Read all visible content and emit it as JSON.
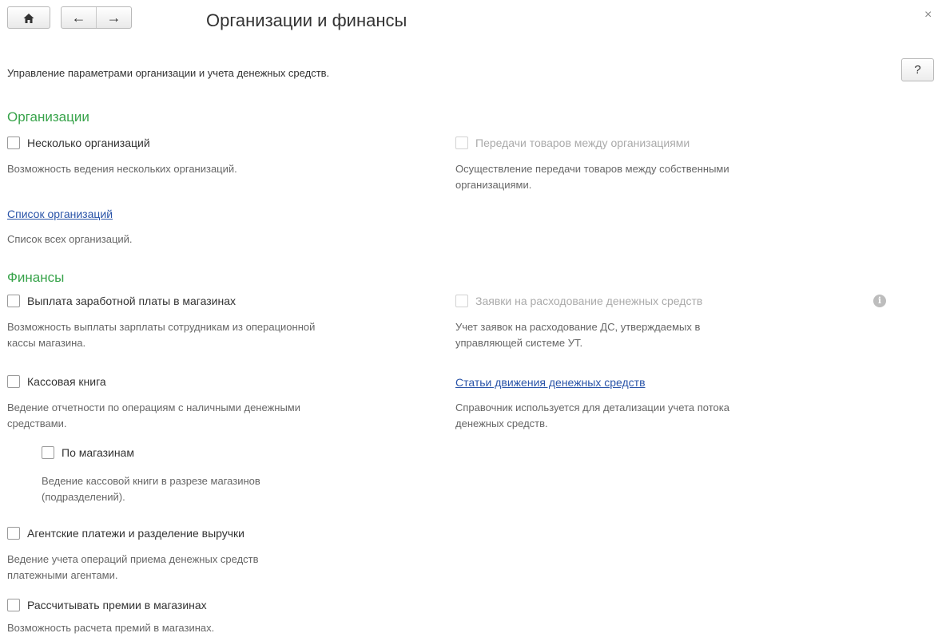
{
  "header": {
    "home_icon": "home-icon",
    "back_icon": "arrow-left-icon",
    "forward_icon": "arrow-right-icon",
    "title": "Организации и финансы",
    "close_icon": "close-icon"
  },
  "description": "Управление параметрами организации и учета денежных средств.",
  "help_label": "?",
  "organizations": {
    "title": "Организации",
    "multi_org_label": "Несколько организаций",
    "multi_org_note": "Возможность ведения нескольких организаций.",
    "transfer_label": "Передачи товаров между организациями",
    "transfer_note_1": "Осуществление передачи товаров между собственными",
    "transfer_note_2": "организациями.",
    "list_link": "Список организаций",
    "list_note": "Список всех организаций."
  },
  "finance": {
    "title": "Финансы",
    "salary_label": "Выплата заработной платы в магазинах",
    "salary_note_1": "Возможность выплаты зарплаты сотрудникам из операционной",
    "salary_note_2": "кассы магазина.",
    "requests_label": "Заявки на расходование денежных средств",
    "requests_note_1": "Учет заявок на расходование ДС, утверждаемых в",
    "requests_note_2": "управляющей системе УТ.",
    "cashbook_label": "Кассовая книга",
    "cashbook_note_1": "Ведение отчетности по операциям с наличными денежными",
    "cashbook_note_2": "средствами.",
    "cashflow_link": "Статьи движения денежных средств",
    "cashflow_note_1": "Справочник используется для детализации учета потока",
    "cashflow_note_2": "денежных средств.",
    "by_stores_label": "По магазинам",
    "by_stores_note_1": "Ведение кассовой книги в разрезе магазинов",
    "by_stores_note_2": "(подразделений).",
    "agent_label": "Агентские платежи и разделение выручки",
    "agent_note_1": "Ведение учета операций приема денежных средств",
    "agent_note_2": "платежными агентами.",
    "bonus_label": "Рассчитывать премии в магазинах",
    "bonus_note": "Возможность расчета премий в магазинах."
  },
  "colors": {
    "section_title": "#37a34a",
    "link": "#2a54a8",
    "disabled_text": "#aaaaaa"
  }
}
